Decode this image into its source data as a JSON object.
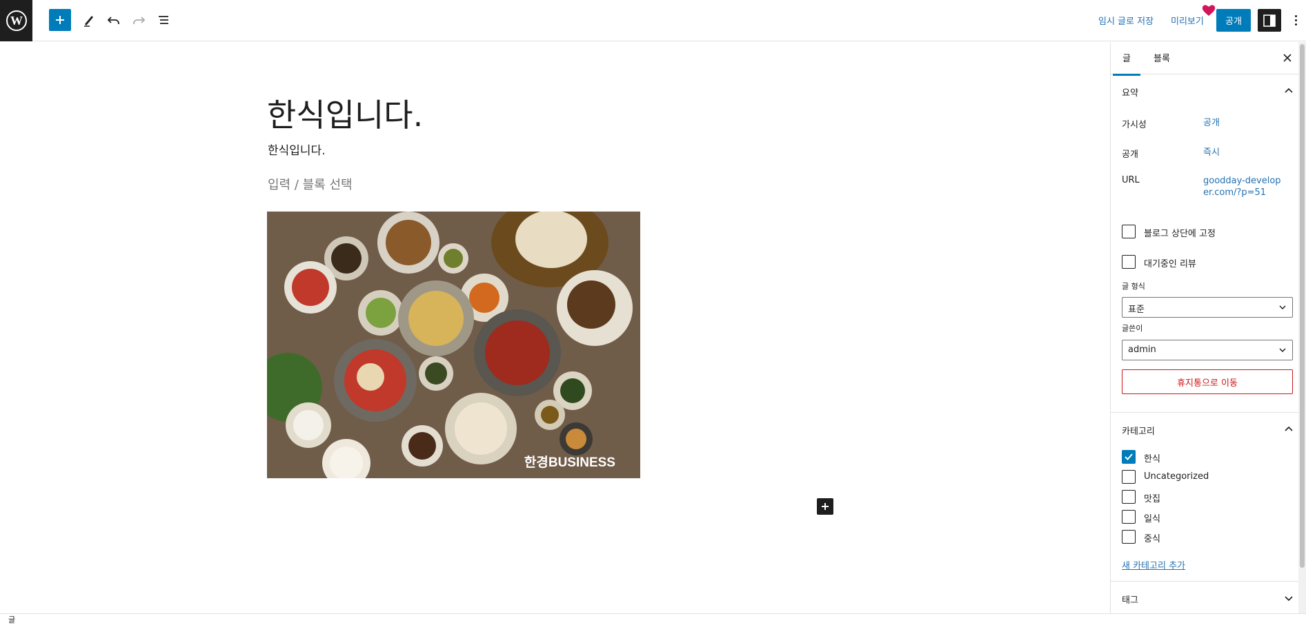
{
  "topbar": {
    "save_draft": "임시 글로 저장",
    "preview": "미리보기",
    "publish": "공개"
  },
  "editor": {
    "title": "한식입니다.",
    "paragraph": "한식입니다.",
    "block_placeholder": "입력 / 블록 선택",
    "image_watermark": "한경BUSINESS"
  },
  "sidebar": {
    "tabs": [
      "글",
      "블록"
    ],
    "summary": {
      "title": "요약",
      "visibility_label": "가시성",
      "visibility_value": "공개",
      "publish_label": "공개",
      "publish_value": "즉시",
      "url_label": "URL",
      "url_value": "goodday-developer.com/?p=51",
      "sticky_label": "블로그 상단에 고정",
      "pending_label": "대기중인 리뷰",
      "format_label": "글 형식",
      "format_value": "표준",
      "author_label": "글쓴이",
      "author_value": "admin",
      "trash_label": "휴지통으로 이동"
    },
    "categories": {
      "title": "카테고리",
      "items": [
        {
          "label": "한식",
          "checked": true
        },
        {
          "label": "Uncategorized",
          "checked": false
        },
        {
          "label": "맛집",
          "checked": false
        },
        {
          "label": "일식",
          "checked": false
        },
        {
          "label": "중식",
          "checked": false
        }
      ],
      "add_new": "새 카테고리 추가"
    },
    "tags": {
      "title": "태그"
    }
  },
  "footer": {
    "breadcrumb": "글"
  },
  "colors": {
    "accent": "#007cba",
    "danger": "#cc1818",
    "link": "#2271b1",
    "dark": "#1e1e1e"
  }
}
